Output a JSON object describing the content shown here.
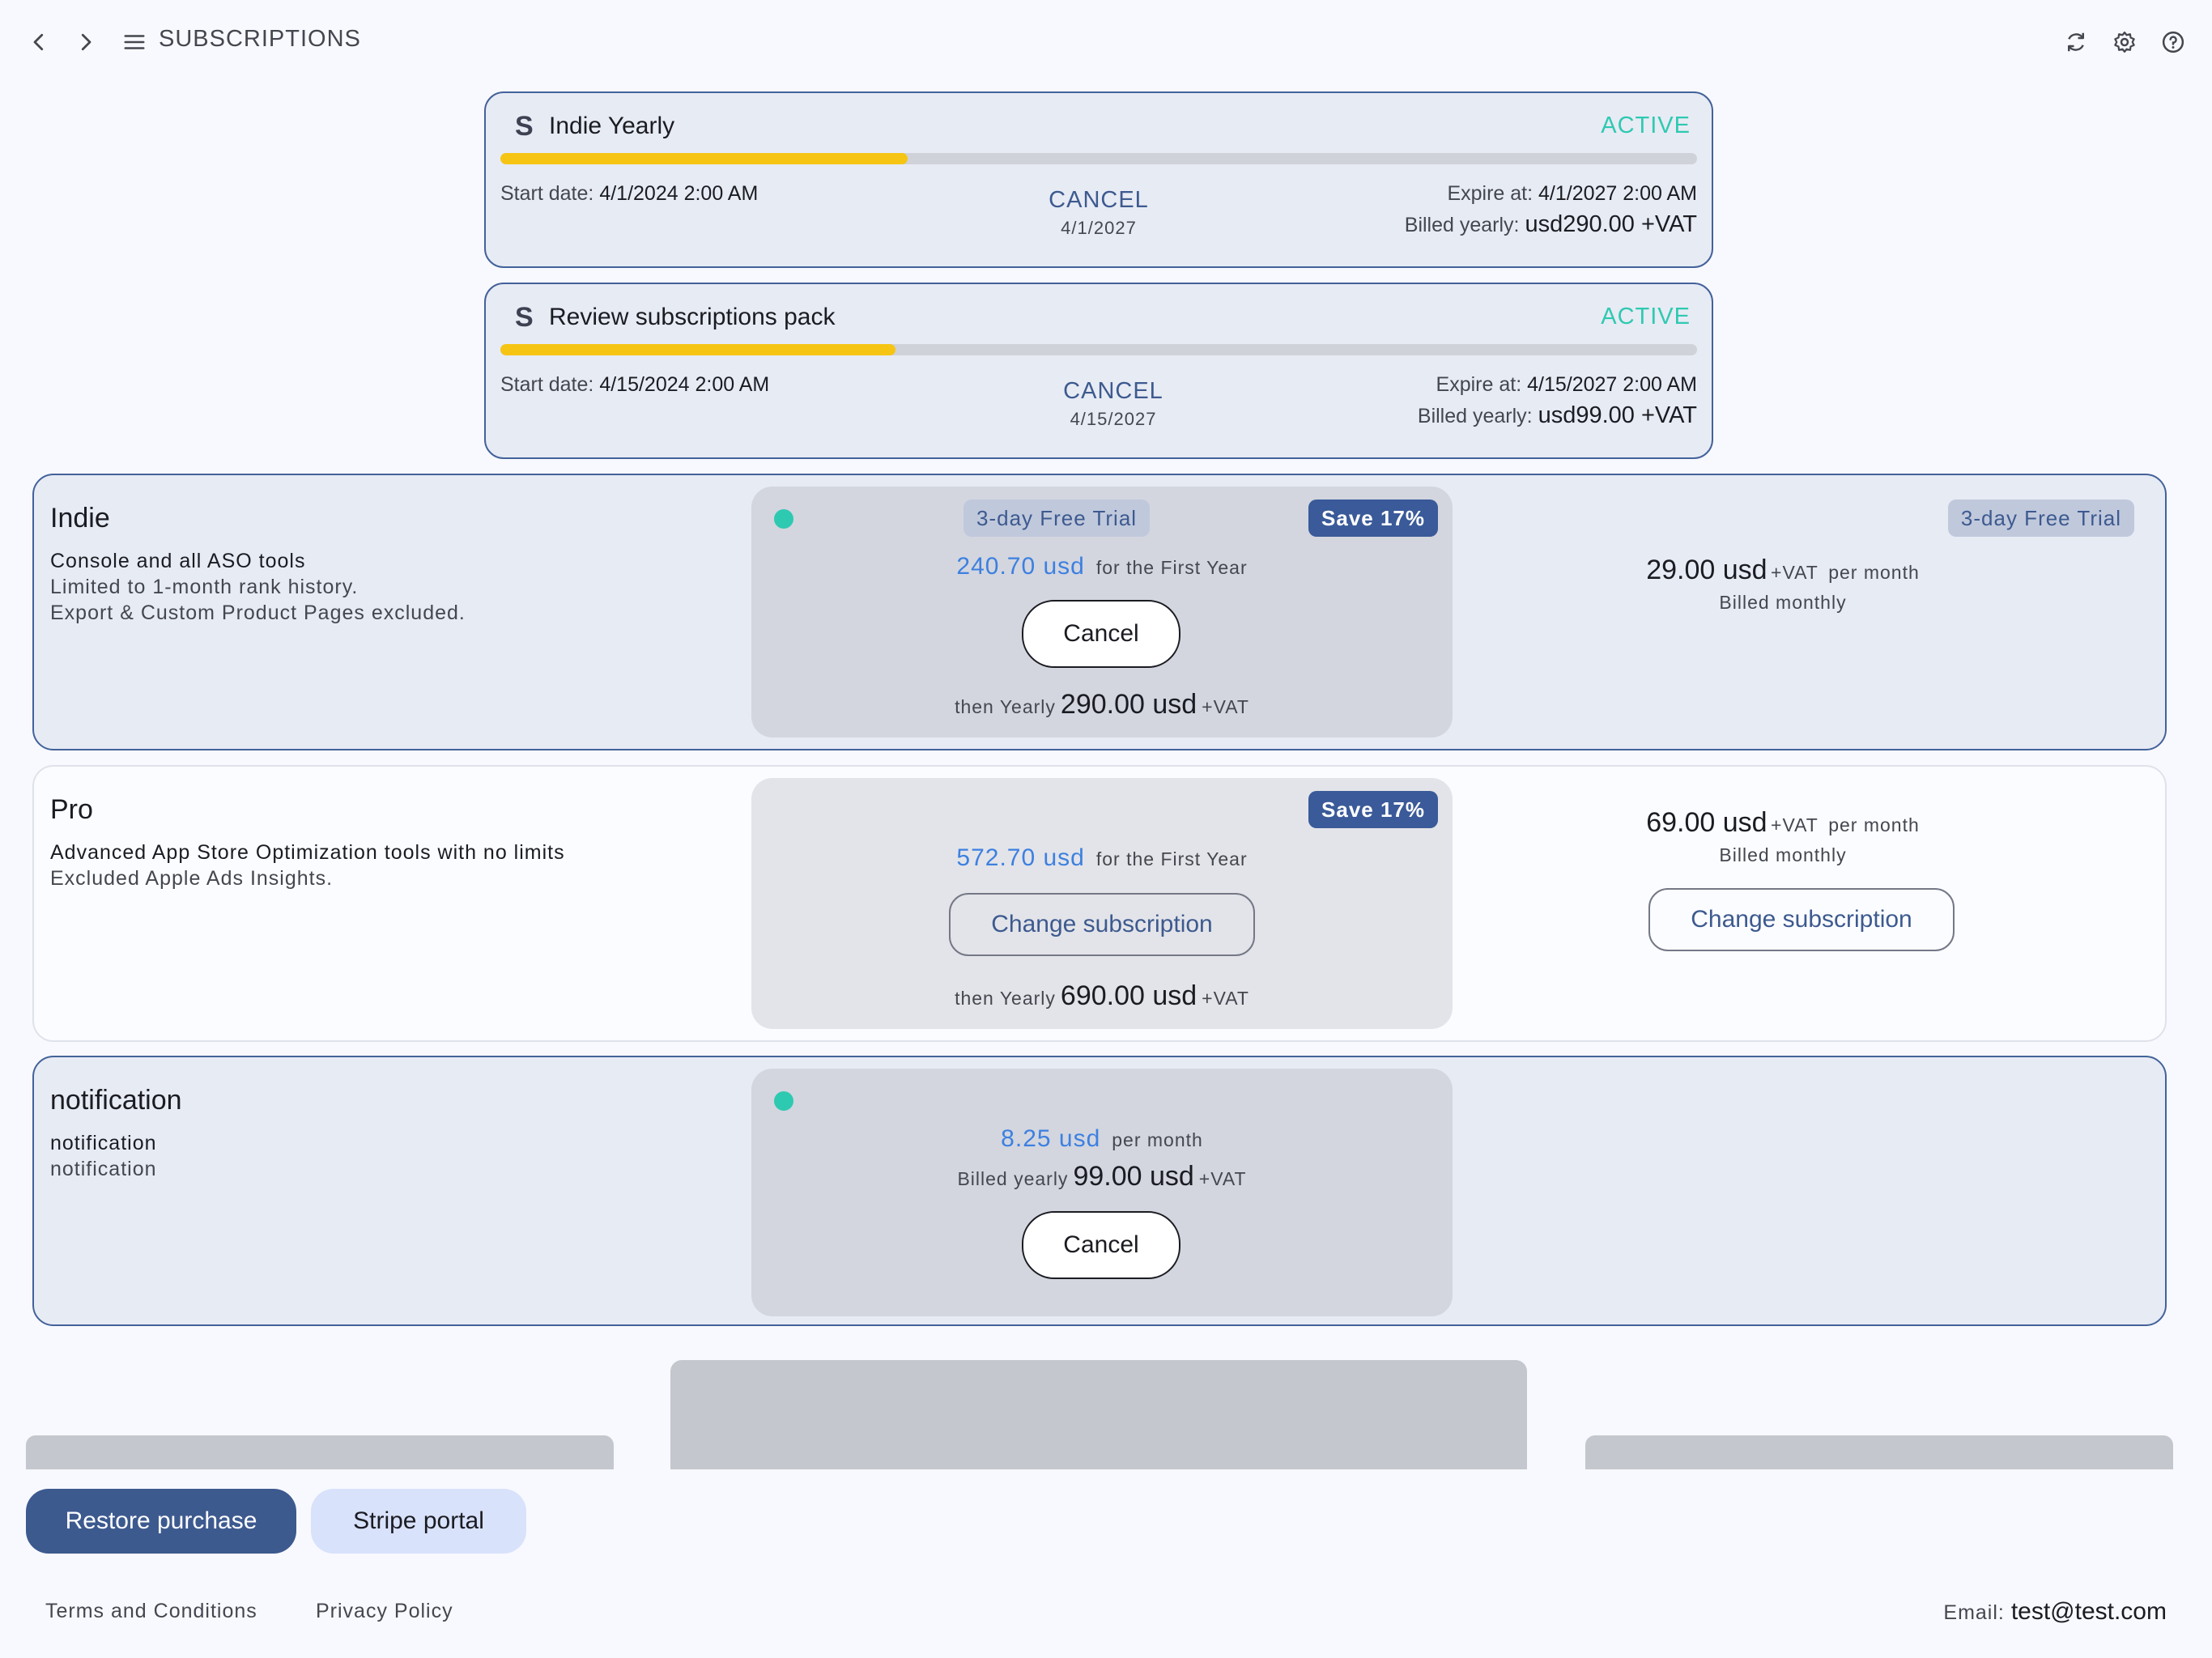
{
  "header": {
    "title": "SUBSCRIPTIONS",
    "back_icon": "chevron-left-icon",
    "forward_icon": "chevron-right-icon",
    "menu_icon": "menu-icon",
    "refresh_icon": "refresh-icon",
    "settings_icon": "gear-icon",
    "help_icon": "help-icon"
  },
  "active_subscriptions": [
    {
      "badge": "S",
      "name": "Indie Yearly",
      "status": "ACTIVE",
      "progress": 0.34,
      "start_label": "Start date:",
      "start_value": "4/1/2024 2:00 AM",
      "cancel_label": "CANCEL",
      "cancel_date": "4/1/2027",
      "expire_label": "Expire at:",
      "expire_value": "4/1/2027 2:00 AM",
      "billed_label": "Billed yearly:",
      "billed_value": "usd290.00 +VAT"
    },
    {
      "badge": "S",
      "name": "Review subscriptions pack",
      "status": "ACTIVE",
      "progress": 0.33,
      "start_label": "Start date:",
      "start_value": "4/15/2024 2:00 AM",
      "cancel_label": "CANCEL",
      "cancel_date": "4/15/2027",
      "expire_label": "Expire at:",
      "expire_value": "4/15/2027 2:00 AM",
      "billed_label": "Billed yearly:",
      "billed_value": "usd99.00 +VAT"
    }
  ],
  "plans": {
    "indie": {
      "title": "Indie",
      "desc1": "Console and all ASO tools",
      "desc2": "Limited to 1-month rank history.",
      "desc3": "Export & Custom Product Pages excluded.",
      "yearly": {
        "trial": "3-day Free Trial",
        "save": "Save 17%",
        "price": "240.70 usd",
        "price_suffix": "for the First Year",
        "button": "Cancel",
        "then_prefix": "then Yearly",
        "then_price": "290.00 usd",
        "then_vat": "+VAT"
      },
      "monthly": {
        "trial": "3-day Free Trial",
        "price": "29.00 usd",
        "vat": "+VAT",
        "period": "per month",
        "billed": "Billed monthly"
      }
    },
    "pro": {
      "title": "Pro",
      "desc1": "Advanced App Store Optimization tools with no limits",
      "desc2": "Excluded Apple Ads Insights.",
      "yearly": {
        "save": "Save 17%",
        "price": "572.70 usd",
        "price_suffix": "for the First Year",
        "button": "Change subscription",
        "then_prefix": "then Yearly",
        "then_price": "690.00 usd",
        "then_vat": "+VAT"
      },
      "monthly": {
        "price": "69.00 usd",
        "vat": "+VAT",
        "period": "per month",
        "billed": "Billed monthly",
        "button": "Change subscription"
      }
    },
    "notification": {
      "title": "notification",
      "desc1": "notification",
      "desc2": "notification",
      "box": {
        "price": "8.25 usd",
        "period": "per month",
        "billed_prefix": "Billed yearly",
        "billed_price": "99.00 usd",
        "billed_vat": "+VAT",
        "button": "Cancel"
      }
    }
  },
  "footer": {
    "restore": "Restore purchase",
    "stripe": "Stripe portal",
    "terms": "Terms and Conditions",
    "privacy": "Privacy Policy",
    "email_label": "Email:",
    "email_value": "test@test.com"
  },
  "colors": {
    "accent": "#3d5a8f",
    "active": "#2fc9b1",
    "progress": "#f6c513",
    "price": "#3d80e0"
  }
}
